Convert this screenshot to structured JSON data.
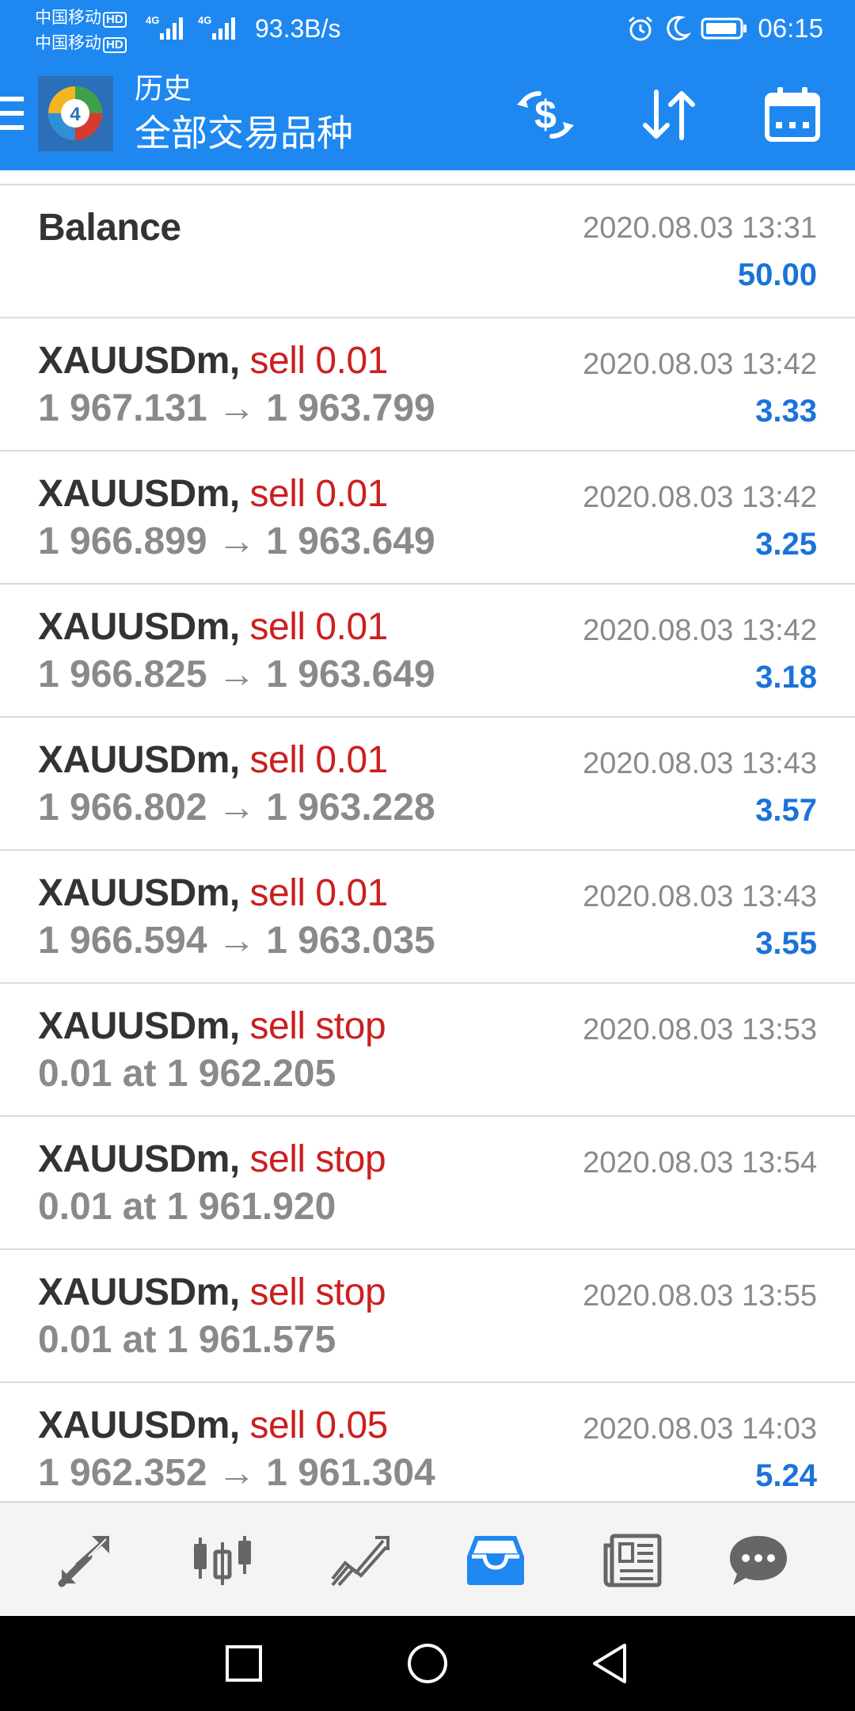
{
  "status_bar": {
    "carrier1": "中国移动",
    "carrier2": "中国移动",
    "hd_label": "HD",
    "net1": "4G",
    "net2": "4G",
    "net_speed": "93.3B/s",
    "time": "06:15"
  },
  "header": {
    "subtitle": "历史",
    "title": "全部交易品种",
    "icons": [
      "menu-icon",
      "metatrader-logo",
      "currency-exchange-icon",
      "sort-icon",
      "calendar-icon"
    ]
  },
  "rows": [
    {
      "symbol": "Balance",
      "type": "",
      "detail": "",
      "time": "2020.08.03 13:31",
      "profit": "50.00"
    },
    {
      "symbol": "XAUUSDm,",
      "type": "sell 0.01",
      "detail": "1 967.131 → 1 963.799",
      "time": "2020.08.03 13:42",
      "profit": "3.33"
    },
    {
      "symbol": "XAUUSDm,",
      "type": "sell 0.01",
      "detail": "1 966.899 → 1 963.649",
      "time": "2020.08.03 13:42",
      "profit": "3.25"
    },
    {
      "symbol": "XAUUSDm,",
      "type": "sell 0.01",
      "detail": "1 966.825 → 1 963.649",
      "time": "2020.08.03 13:42",
      "profit": "3.18"
    },
    {
      "symbol": "XAUUSDm,",
      "type": "sell 0.01",
      "detail": "1 966.802 → 1 963.228",
      "time": "2020.08.03 13:43",
      "profit": "3.57"
    },
    {
      "symbol": "XAUUSDm,",
      "type": "sell 0.01",
      "detail": "1 966.594 → 1 963.035",
      "time": "2020.08.03 13:43",
      "profit": "3.55"
    },
    {
      "symbol": "XAUUSDm,",
      "type": "sell stop",
      "detail": "0.01 at 1 962.205",
      "time": "2020.08.03 13:53",
      "profit": ""
    },
    {
      "symbol": "XAUUSDm,",
      "type": "sell stop",
      "detail": "0.01 at 1 961.920",
      "time": "2020.08.03 13:54",
      "profit": ""
    },
    {
      "symbol": "XAUUSDm,",
      "type": "sell stop",
      "detail": "0.01 at 1 961.575",
      "time": "2020.08.03 13:55",
      "profit": ""
    },
    {
      "symbol": "XAUUSDm,",
      "type": "sell 0.05",
      "detail": "1 962.352 → 1 961.304",
      "time": "2020.08.03 14:03",
      "profit": "5.24"
    }
  ],
  "tabs": [
    {
      "icon": "quotes-icon",
      "active": false
    },
    {
      "icon": "chart-icon",
      "active": false
    },
    {
      "icon": "trade-icon",
      "active": false
    },
    {
      "icon": "history-icon",
      "active": true
    },
    {
      "icon": "news-icon",
      "active": false
    },
    {
      "icon": "messages-icon",
      "active": false
    }
  ],
  "colors": {
    "header_bg": "#1e88f0",
    "sell": "#cc1f1f",
    "profit": "#1a73d9",
    "active_tab": "#1e88f0",
    "inactive_tab": "#666666"
  }
}
